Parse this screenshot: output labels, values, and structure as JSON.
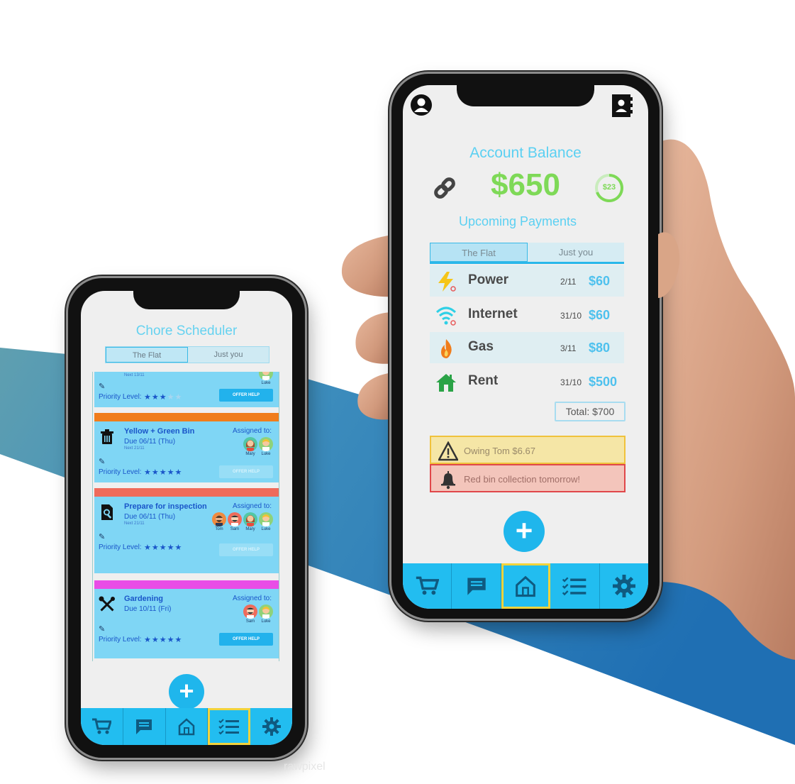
{
  "colors": {
    "accent_blue": "#22bdf0",
    "title_blue": "#5bd0f2",
    "balance_green": "#7ed957",
    "amount_blue": "#4ec1ee",
    "warning_yellow": "#f5e6a6",
    "alert_red": "#f3c5bb"
  },
  "chore_app": {
    "title": "Chore Scheduler",
    "tabs": [
      "The Flat",
      "Just you"
    ],
    "cards": [
      {
        "title": "",
        "due": "",
        "next": "Next 13/11",
        "assigned_label": "",
        "names": [
          "Luke"
        ],
        "priority_label": "Priority Level:",
        "stars": 3,
        "help_label": "OFFER HELP",
        "icon": "none"
      },
      {
        "bar_color": "#f07d1b",
        "title": "Yellow + Green Bin",
        "due": "Due 06/11 (Thu)",
        "next": "Next 21/11",
        "assigned_label": "Assigned to:",
        "names": [
          "Mary",
          "Luke"
        ],
        "priority_label": "Priority Level:",
        "stars": 5,
        "help_label": "OFFER HELP",
        "icon": "trash-icon"
      },
      {
        "bar_color": "#ef6b5b",
        "title": "Prepare for inspection",
        "due": "Due 06/11 (Thu)",
        "next": "Next 21/11",
        "assigned_label": "Assigned to:",
        "names": [
          "Tom",
          "Sam",
          "Mary",
          "Luke"
        ],
        "priority_label": "Priority Level:",
        "stars": 5,
        "help_label": "OFFER HELP",
        "icon": "search-document-icon"
      },
      {
        "bar_color": "#e94de6",
        "title": "Gardening",
        "due": "Due 10/11 (Fri)",
        "next": "",
        "assigned_label": "Assigned to:",
        "names": [
          "Sam",
          "Luke"
        ],
        "priority_label": "Priority Level:",
        "stars": 5,
        "help_label": "OFFER HELP",
        "icon": "tools-icon"
      }
    ],
    "fab_label": "+",
    "nav": [
      "cart-icon",
      "chat-icon",
      "home-icon",
      "checklist-icon",
      "gear-icon"
    ],
    "active_nav": "checklist-icon"
  },
  "finance_app": {
    "title": "Account Balance",
    "balance": "$650",
    "ring_value": "$23",
    "upcoming_title": "Upcoming Payments",
    "tabs": [
      "The Flat",
      "Just you"
    ],
    "payments": [
      {
        "name": "Power",
        "date": "2/11",
        "amount": "$60",
        "icon": "lightning-icon"
      },
      {
        "name": "Internet",
        "date": "31/10",
        "amount": "$60",
        "icon": "wifi-icon"
      },
      {
        "name": "Gas",
        "date": "3/11",
        "amount": "$80",
        "icon": "flame-icon"
      },
      {
        "name": "Rent",
        "date": "31/10",
        "amount": "$500",
        "icon": "house-icon"
      }
    ],
    "total": "Total: $700",
    "alerts": [
      {
        "text": "Owing Tom $6.67",
        "icon": "warning-icon"
      },
      {
        "text": "Red bin collection tomorrow!",
        "icon": "bell-icon"
      }
    ],
    "fab_label": "+",
    "nav": [
      "cart-icon",
      "chat-icon",
      "home-icon",
      "checklist-icon",
      "gear-icon"
    ],
    "active_nav": "home-icon"
  },
  "watermark": "rawpixel"
}
